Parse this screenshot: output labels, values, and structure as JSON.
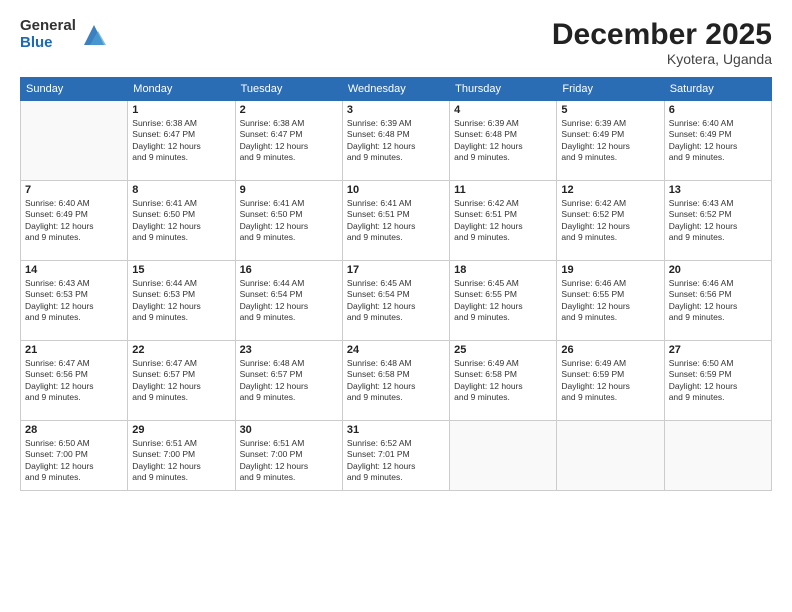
{
  "logo": {
    "general": "General",
    "blue": "Blue"
  },
  "title": {
    "month_year": "December 2025",
    "location": "Kyotera, Uganda"
  },
  "weekdays": [
    "Sunday",
    "Monday",
    "Tuesday",
    "Wednesday",
    "Thursday",
    "Friday",
    "Saturday"
  ],
  "weeks": [
    [
      {
        "day": "",
        "info": ""
      },
      {
        "day": "1",
        "info": "Sunrise: 6:38 AM\nSunset: 6:47 PM\nDaylight: 12 hours\nand 9 minutes."
      },
      {
        "day": "2",
        "info": "Sunrise: 6:38 AM\nSunset: 6:47 PM\nDaylight: 12 hours\nand 9 minutes."
      },
      {
        "day": "3",
        "info": "Sunrise: 6:39 AM\nSunset: 6:48 PM\nDaylight: 12 hours\nand 9 minutes."
      },
      {
        "day": "4",
        "info": "Sunrise: 6:39 AM\nSunset: 6:48 PM\nDaylight: 12 hours\nand 9 minutes."
      },
      {
        "day": "5",
        "info": "Sunrise: 6:39 AM\nSunset: 6:49 PM\nDaylight: 12 hours\nand 9 minutes."
      },
      {
        "day": "6",
        "info": "Sunrise: 6:40 AM\nSunset: 6:49 PM\nDaylight: 12 hours\nand 9 minutes."
      }
    ],
    [
      {
        "day": "7",
        "info": "Sunrise: 6:40 AM\nSunset: 6:49 PM\nDaylight: 12 hours\nand 9 minutes."
      },
      {
        "day": "8",
        "info": "Sunrise: 6:41 AM\nSunset: 6:50 PM\nDaylight: 12 hours\nand 9 minutes."
      },
      {
        "day": "9",
        "info": "Sunrise: 6:41 AM\nSunset: 6:50 PM\nDaylight: 12 hours\nand 9 minutes."
      },
      {
        "day": "10",
        "info": "Sunrise: 6:41 AM\nSunset: 6:51 PM\nDaylight: 12 hours\nand 9 minutes."
      },
      {
        "day": "11",
        "info": "Sunrise: 6:42 AM\nSunset: 6:51 PM\nDaylight: 12 hours\nand 9 minutes."
      },
      {
        "day": "12",
        "info": "Sunrise: 6:42 AM\nSunset: 6:52 PM\nDaylight: 12 hours\nand 9 minutes."
      },
      {
        "day": "13",
        "info": "Sunrise: 6:43 AM\nSunset: 6:52 PM\nDaylight: 12 hours\nand 9 minutes."
      }
    ],
    [
      {
        "day": "14",
        "info": "Sunrise: 6:43 AM\nSunset: 6:53 PM\nDaylight: 12 hours\nand 9 minutes."
      },
      {
        "day": "15",
        "info": "Sunrise: 6:44 AM\nSunset: 6:53 PM\nDaylight: 12 hours\nand 9 minutes."
      },
      {
        "day": "16",
        "info": "Sunrise: 6:44 AM\nSunset: 6:54 PM\nDaylight: 12 hours\nand 9 minutes."
      },
      {
        "day": "17",
        "info": "Sunrise: 6:45 AM\nSunset: 6:54 PM\nDaylight: 12 hours\nand 9 minutes."
      },
      {
        "day": "18",
        "info": "Sunrise: 6:45 AM\nSunset: 6:55 PM\nDaylight: 12 hours\nand 9 minutes."
      },
      {
        "day": "19",
        "info": "Sunrise: 6:46 AM\nSunset: 6:55 PM\nDaylight: 12 hours\nand 9 minutes."
      },
      {
        "day": "20",
        "info": "Sunrise: 6:46 AM\nSunset: 6:56 PM\nDaylight: 12 hours\nand 9 minutes."
      }
    ],
    [
      {
        "day": "21",
        "info": "Sunrise: 6:47 AM\nSunset: 6:56 PM\nDaylight: 12 hours\nand 9 minutes."
      },
      {
        "day": "22",
        "info": "Sunrise: 6:47 AM\nSunset: 6:57 PM\nDaylight: 12 hours\nand 9 minutes."
      },
      {
        "day": "23",
        "info": "Sunrise: 6:48 AM\nSunset: 6:57 PM\nDaylight: 12 hours\nand 9 minutes."
      },
      {
        "day": "24",
        "info": "Sunrise: 6:48 AM\nSunset: 6:58 PM\nDaylight: 12 hours\nand 9 minutes."
      },
      {
        "day": "25",
        "info": "Sunrise: 6:49 AM\nSunset: 6:58 PM\nDaylight: 12 hours\nand 9 minutes."
      },
      {
        "day": "26",
        "info": "Sunrise: 6:49 AM\nSunset: 6:59 PM\nDaylight: 12 hours\nand 9 minutes."
      },
      {
        "day": "27",
        "info": "Sunrise: 6:50 AM\nSunset: 6:59 PM\nDaylight: 12 hours\nand 9 minutes."
      }
    ],
    [
      {
        "day": "28",
        "info": "Sunrise: 6:50 AM\nSunset: 7:00 PM\nDaylight: 12 hours\nand 9 minutes."
      },
      {
        "day": "29",
        "info": "Sunrise: 6:51 AM\nSunset: 7:00 PM\nDaylight: 12 hours\nand 9 minutes."
      },
      {
        "day": "30",
        "info": "Sunrise: 6:51 AM\nSunset: 7:00 PM\nDaylight: 12 hours\nand 9 minutes."
      },
      {
        "day": "31",
        "info": "Sunrise: 6:52 AM\nSunset: 7:01 PM\nDaylight: 12 hours\nand 9 minutes."
      },
      {
        "day": "",
        "info": ""
      },
      {
        "day": "",
        "info": ""
      },
      {
        "day": "",
        "info": ""
      }
    ]
  ]
}
